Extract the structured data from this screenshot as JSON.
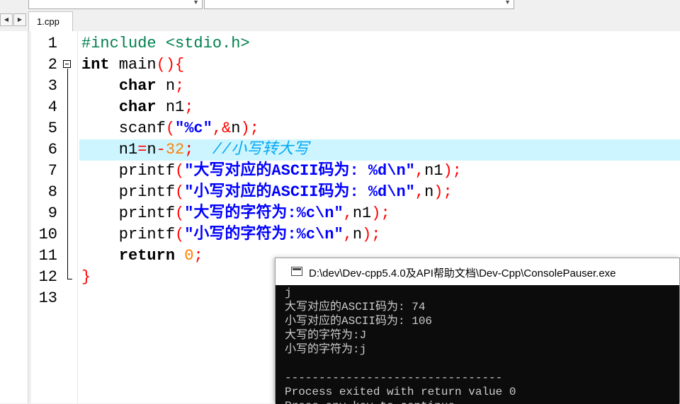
{
  "tab": {
    "label": "1.cpp"
  },
  "nav": {
    "left_icon": "◀",
    "right_icon": "▶"
  },
  "editor": {
    "line_numbers": [
      "1",
      "2",
      "3",
      "4",
      "5",
      "6",
      "7",
      "8",
      "9",
      "10",
      "11",
      "12",
      "13"
    ],
    "highlight_line": 6,
    "lines": [
      [
        {
          "t": "#include <stdio.h>",
          "c": "pp"
        }
      ],
      [
        {
          "t": "int",
          "c": "kw"
        },
        {
          "t": " main",
          "c": ""
        },
        {
          "t": "(){",
          "c": "op"
        }
      ],
      [
        {
          "t": "    ",
          "c": ""
        },
        {
          "t": "char",
          "c": "kw"
        },
        {
          "t": " n",
          "c": ""
        },
        {
          "t": ";",
          "c": "op"
        }
      ],
      [
        {
          "t": "    ",
          "c": ""
        },
        {
          "t": "char",
          "c": "kw"
        },
        {
          "t": " n1",
          "c": ""
        },
        {
          "t": ";",
          "c": "op"
        }
      ],
      [
        {
          "t": "    scanf",
          "c": ""
        },
        {
          "t": "(",
          "c": "op"
        },
        {
          "t": "\"%c\"",
          "c": "st"
        },
        {
          "t": ",&",
          "c": "op"
        },
        {
          "t": "n",
          "c": ""
        },
        {
          "t": ");",
          "c": "op"
        }
      ],
      [
        {
          "t": "    n1",
          "c": ""
        },
        {
          "t": "=",
          "c": "op"
        },
        {
          "t": "n",
          "c": ""
        },
        {
          "t": "-",
          "c": "op"
        },
        {
          "t": "32",
          "c": "num"
        },
        {
          "t": ";",
          "c": "op"
        },
        {
          "t": "  //小写转大写",
          "c": "cm"
        }
      ],
      [
        {
          "t": "    printf",
          "c": ""
        },
        {
          "t": "(",
          "c": "op"
        },
        {
          "t": "\"大写对应的ASCII码为: %d\\n\"",
          "c": "st"
        },
        {
          "t": ",",
          "c": "op"
        },
        {
          "t": "n1",
          "c": ""
        },
        {
          "t": ");",
          "c": "op"
        }
      ],
      [
        {
          "t": "    printf",
          "c": ""
        },
        {
          "t": "(",
          "c": "op"
        },
        {
          "t": "\"小写对应的ASCII码为: %d\\n\"",
          "c": "st"
        },
        {
          "t": ",",
          "c": "op"
        },
        {
          "t": "n",
          "c": ""
        },
        {
          "t": ");",
          "c": "op"
        }
      ],
      [
        {
          "t": "    printf",
          "c": ""
        },
        {
          "t": "(",
          "c": "op"
        },
        {
          "t": "\"大写的字符为:%c\\n\"",
          "c": "st"
        },
        {
          "t": ",",
          "c": "op"
        },
        {
          "t": "n1",
          "c": ""
        },
        {
          "t": ");",
          "c": "op"
        }
      ],
      [
        {
          "t": "    printf",
          "c": ""
        },
        {
          "t": "(",
          "c": "op"
        },
        {
          "t": "\"小写的字符为:%c\\n\"",
          "c": "st"
        },
        {
          "t": ",",
          "c": "op"
        },
        {
          "t": "n",
          "c": ""
        },
        {
          "t": ");",
          "c": "op"
        }
      ],
      [
        {
          "t": "    ",
          "c": ""
        },
        {
          "t": "return",
          "c": "kw"
        },
        {
          "t": " ",
          "c": ""
        },
        {
          "t": "0",
          "c": "num"
        },
        {
          "t": ";",
          "c": "op"
        }
      ],
      [
        {
          "t": "}",
          "c": "op"
        }
      ],
      []
    ]
  },
  "colors": {
    "preprocessor": "#00804e",
    "operator": "#ff0000",
    "string": "#0000ff",
    "number": "#ff7f00",
    "comment": "#00a8f5",
    "highlight": "#cdf5ff",
    "console_bg": "#0c0c0c",
    "console_text": "#cccccc"
  },
  "console": {
    "title": "D:\\dev\\Dev-cpp5.4.0及API帮助文档\\Dev-Cpp\\ConsolePauser.exe",
    "output": [
      "j",
      "大写对应的ASCII码为: 74",
      "小写对应的ASCII码为: 106",
      "大写的字符为:J",
      "小写的字符为:j",
      "",
      "--------------------------------",
      "Process exited with return value 0",
      "Press any key to continue . . ."
    ]
  }
}
